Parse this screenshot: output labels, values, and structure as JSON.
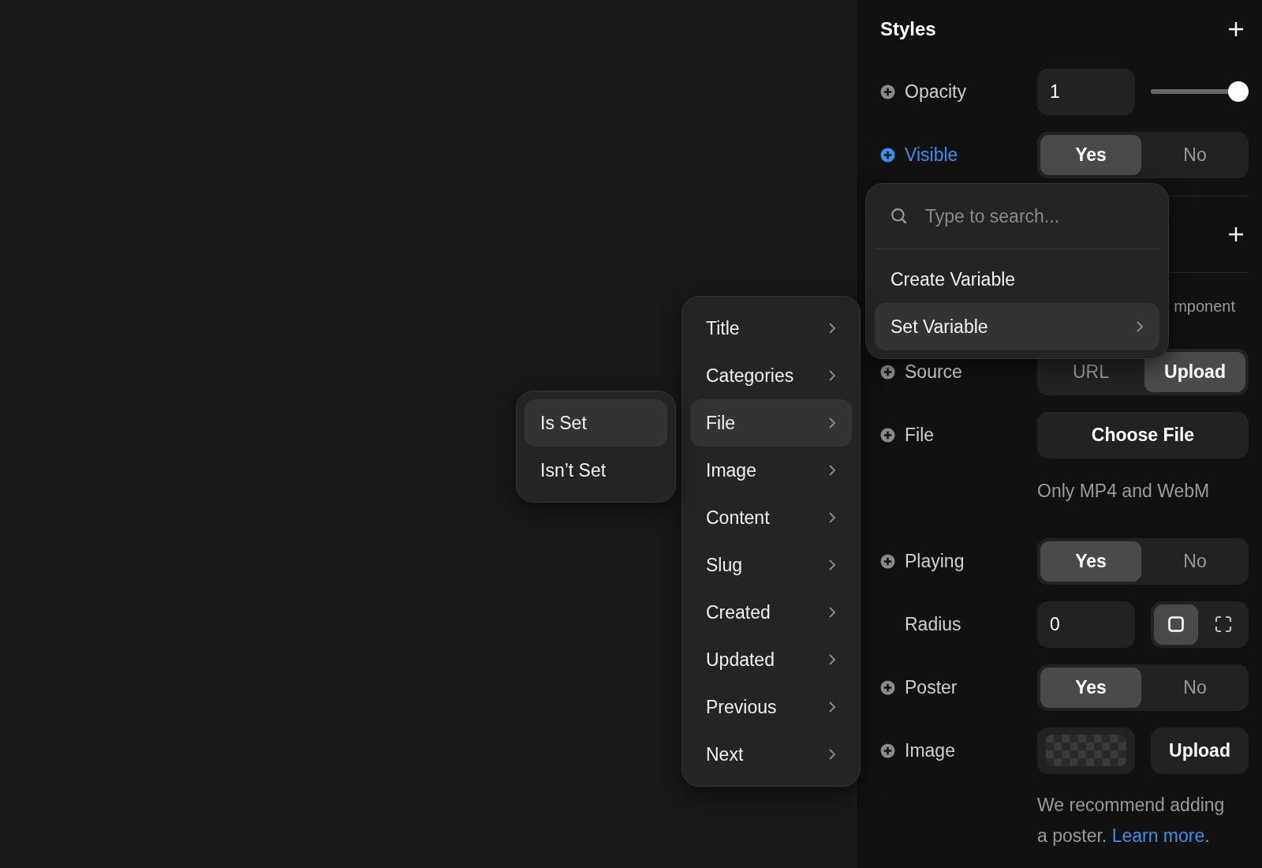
{
  "styles": {
    "title": "Styles",
    "rows": [
      {
        "kind": "slider",
        "label": "Opacity",
        "addable": true,
        "bound": false,
        "value": "1",
        "level": 1
      },
      {
        "kind": "toggle",
        "label": "Visible",
        "addable": true,
        "bound": true,
        "options": [
          {
            "label": "Yes",
            "selected": true
          },
          {
            "label": "No",
            "selected": false
          }
        ]
      }
    ]
  },
  "component": {
    "partial_label": "mponent",
    "rows": [
      {
        "kind": "toggle",
        "label": "Source",
        "addable": true,
        "bound": false,
        "options": [
          {
            "label": "URL",
            "selected": false
          },
          {
            "label": "Upload",
            "selected": true
          }
        ]
      },
      {
        "kind": "button",
        "label": "File",
        "addable": true,
        "bound": false,
        "button": "Choose File"
      },
      {
        "kind": "hint",
        "text": "Only MP4 and WebM"
      },
      {
        "kind": "toggle",
        "label": "Playing",
        "addable": true,
        "bound": false,
        "options": [
          {
            "label": "Yes",
            "selected": true
          },
          {
            "label": "No",
            "selected": false
          }
        ]
      },
      {
        "kind": "radius",
        "label": "Radius",
        "addable": false,
        "bound": false,
        "value": "0",
        "modes": [
          {
            "kind": "uniform",
            "selected": true
          },
          {
            "kind": "individual",
            "selected": false
          }
        ]
      },
      {
        "kind": "toggle",
        "label": "Poster",
        "addable": true,
        "bound": false,
        "options": [
          {
            "label": "Yes",
            "selected": true
          },
          {
            "label": "No",
            "selected": false
          }
        ]
      },
      {
        "kind": "image",
        "label": "Image",
        "addable": true,
        "bound": false,
        "button": "Upload"
      },
      {
        "kind": "note",
        "text": "We recommend adding a poster.",
        "link": "Learn more",
        "end": "."
      }
    ]
  },
  "variable_menu": {
    "placeholder": "Type to search...",
    "items": [
      {
        "label": "Create Variable",
        "selected": false,
        "submenu": false
      },
      {
        "label": "Set Variable",
        "selected": true,
        "submenu": true
      }
    ]
  },
  "field_menu": {
    "items": [
      {
        "label": "Title",
        "selected": false
      },
      {
        "label": "Categories",
        "selected": false
      },
      {
        "label": "File",
        "selected": true
      },
      {
        "label": "Image",
        "selected": false
      },
      {
        "label": "Content",
        "selected": false
      },
      {
        "label": "Slug",
        "selected": false
      },
      {
        "label": "Created",
        "selected": false
      },
      {
        "label": "Updated",
        "selected": false
      },
      {
        "label": "Previous",
        "selected": false
      },
      {
        "label": "Next",
        "selected": false
      }
    ]
  },
  "condition_menu": {
    "items": [
      {
        "label": "Is Set",
        "selected": true
      },
      {
        "label": "Isn’t Set",
        "selected": false
      }
    ]
  }
}
